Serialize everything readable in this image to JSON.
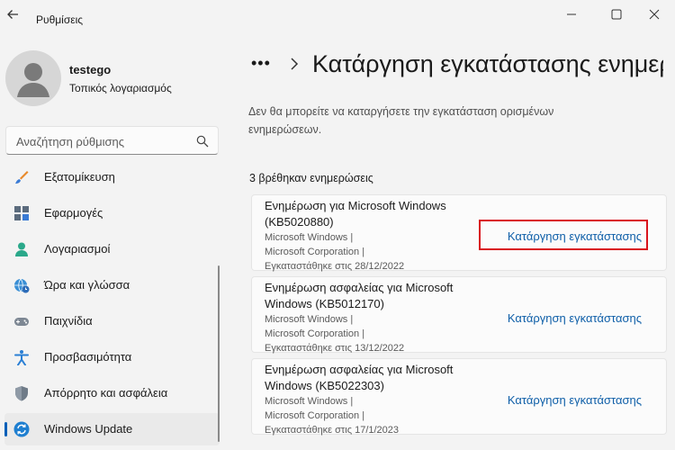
{
  "app": {
    "title": "Ρυθμίσεις"
  },
  "user": {
    "name": "testego",
    "account": "Τοπικός λογαριασμός"
  },
  "search": {
    "placeholder": "Αναζήτηση ρύθμισης"
  },
  "sidebar": {
    "items": [
      {
        "label": "Εξατομίκευση",
        "icon": "brush-icon"
      },
      {
        "label": "Εφαρμογές",
        "icon": "apps-icon"
      },
      {
        "label": "Λογαριασμοί",
        "icon": "person-icon"
      },
      {
        "label": "Ώρα και γλώσσα",
        "icon": "globe-clock-icon"
      },
      {
        "label": "Παιχνίδια",
        "icon": "gamepad-icon"
      },
      {
        "label": "Προσβασιμότητα",
        "icon": "accessibility-icon"
      },
      {
        "label": "Απόρρητο και ασφάλεια",
        "icon": "shield-icon"
      },
      {
        "label": "Windows Update",
        "icon": "sync-icon"
      }
    ],
    "active": "Windows Update"
  },
  "main": {
    "breadcrumb_more": "•••",
    "title": "Κατάργηση εγκατάστασης ενημερώσεων",
    "description": "Δεν θα μπορείτε να καταργήσετε την εγκατάσταση ορισμένων ενημερώσεων.",
    "count_text": "3 βρέθηκαν ενημερώσεις",
    "updates": [
      {
        "title": "Ενημέρωση για Microsoft Windows (KB5020880)",
        "meta1": "Microsoft Windows   |",
        "meta2": "Microsoft Corporation   |",
        "meta3": "Εγκαταστάθηκε στις 28/12/2022",
        "action": "Κατάργηση εγκατάστασης"
      },
      {
        "title": "Ενημέρωση ασφαλείας για Microsoft Windows (KB5012170)",
        "meta1": "Microsoft Windows   |",
        "meta2": "Microsoft Corporation   |",
        "meta3": "Εγκαταστάθηκε στις 13/12/2022",
        "action": "Κατάργηση εγκατάστασης"
      },
      {
        "title": "Ενημέρωση ασφαλείας για Microsoft Windows (KB5022303)",
        "meta1": "Microsoft Windows   |",
        "meta2": "Microsoft Corporation   |",
        "meta3": "Εγκαταστάθηκε στις 17/1/2023",
        "action": "Κατάργηση εγκατάστασης"
      }
    ]
  },
  "colors": {
    "accent": "#005fb8",
    "link": "#0f5fa8",
    "highlight": "#d9141d"
  }
}
